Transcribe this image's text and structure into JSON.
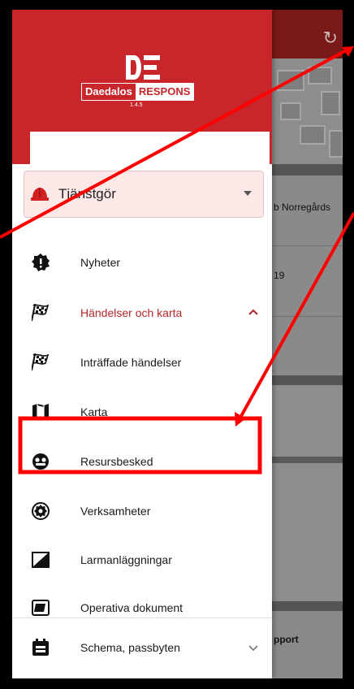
{
  "app": {
    "logo_text": "DE",
    "brand_name": "Daedalos",
    "brand_product": "RESPONS",
    "version": "1.4.5"
  },
  "status": {
    "value": "Tjänstgör"
  },
  "menu": {
    "items": [
      {
        "label": "Nyheter",
        "icon": "news-badge-icon"
      },
      {
        "label": "Händelser och karta",
        "icon": "checkered-flag-icon",
        "active": true,
        "expanded": true
      },
      {
        "label": "Inträffade händelser",
        "icon": "checkered-flag-icon"
      },
      {
        "label": "Karta",
        "icon": "map-icon"
      },
      {
        "label": "Resursbesked",
        "icon": "resource-icon",
        "highlighted": true
      },
      {
        "label": "Verksamheter",
        "icon": "gear-icon"
      },
      {
        "label": "Larmanläggningar",
        "icon": "alarm-system-icon"
      },
      {
        "label": "Operativa dokument",
        "icon": "folder-icon"
      },
      {
        "label": "Schema, passbyten",
        "icon": "calendar-icon",
        "expanded": false
      }
    ]
  },
  "background": {
    "text1": "b Norregårds",
    "text2": "19",
    "text3": "pport"
  },
  "colors": {
    "brand_red": "#c8262a",
    "annotation_red": "#ff0000",
    "active_text": "#b3262a"
  }
}
